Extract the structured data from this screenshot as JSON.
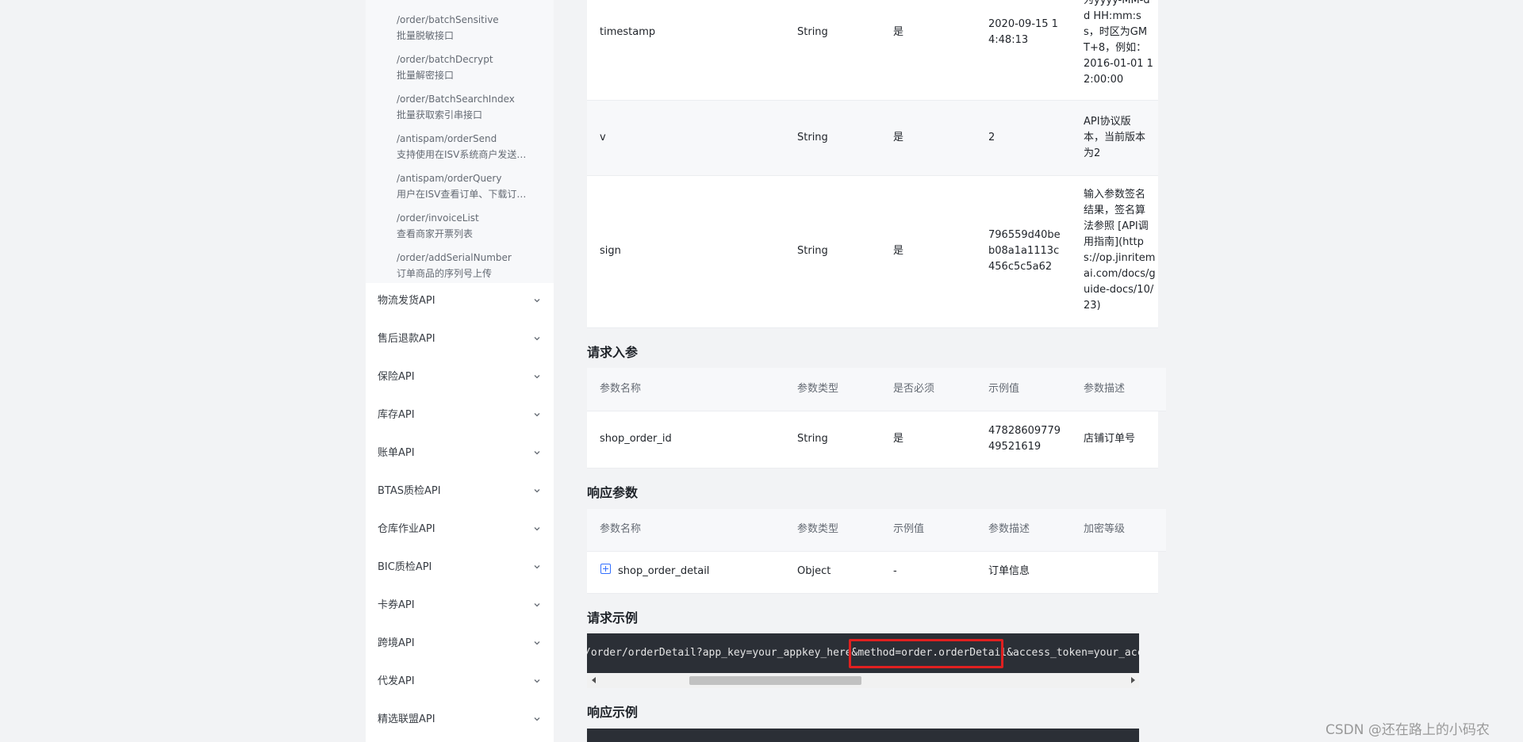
{
  "sidebar": {
    "sub_items": [
      {
        "path": "/order/batchSensitive",
        "desc": "批量脱敏接口"
      },
      {
        "path": "/order/batchDecrypt",
        "desc": "批量解密接口"
      },
      {
        "path": "/order/BatchSearchIndex",
        "desc": "批量获取索引串接口"
      },
      {
        "path": "/antispam/orderSend",
        "desc": "支持使用在ISV系统商户发送（..."
      },
      {
        "path": "/antispam/orderQuery",
        "desc": "用户在ISV查看订单、下载订单..."
      },
      {
        "path": "/order/invoiceList",
        "desc": "查看商家开票列表"
      },
      {
        "path": "/order/addSerialNumber",
        "desc": "订单商品的序列号上传"
      }
    ],
    "categories": [
      {
        "label": "物流发货API"
      },
      {
        "label": "售后退款API"
      },
      {
        "label": "保险API"
      },
      {
        "label": "库存API"
      },
      {
        "label": "账单API"
      },
      {
        "label": "BTAS质检API"
      },
      {
        "label": "仓库作业API"
      },
      {
        "label": "BIC质检API"
      },
      {
        "label": "卡券API"
      },
      {
        "label": "跨境API"
      },
      {
        "label": "代发API"
      },
      {
        "label": "精选联盟API"
      }
    ]
  },
  "common_params": {
    "rows": [
      {
        "name": "timestamp",
        "type": "String",
        "required": "是",
        "example_lines": [
          "2020-09-15 1",
          "4:48:13"
        ],
        "desc_lines": [
          "为yyyy-MM-d",
          "d HH:mm:s",
          "s，时区为GM",
          "T+8，例如：",
          "2016-01-01 1",
          "2:00:00"
        ]
      },
      {
        "name": "v",
        "type": "String",
        "required": "是",
        "example_lines": [
          "2"
        ],
        "desc_lines": [
          "API协议版",
          "本，当前版本",
          "为2"
        ]
      },
      {
        "name": "sign",
        "type": "String",
        "required": "是",
        "example_lines": [
          "796559d40be",
          "b08a1a1113c",
          "456c5c5a62"
        ],
        "desc_lines": [
          "输入参数签名",
          "结果，签名算",
          "法参照 [API调",
          "用指南](http",
          "s://op.jinritem",
          "ai.com/docs/g",
          "uide-docs/10/",
          "23)"
        ]
      }
    ]
  },
  "request_params": {
    "title": "请求入参",
    "headers": [
      "参数名称",
      "参数类型",
      "是否必须",
      "示例值",
      "参数描述"
    ],
    "rows": [
      {
        "name": "shop_order_id",
        "type": "String",
        "required": "是",
        "example_lines": [
          "47828609779",
          "49521619"
        ],
        "desc": "店铺订单号"
      }
    ]
  },
  "response_params": {
    "title": "响应参数",
    "headers": [
      "参数名称",
      "参数类型",
      "示例值",
      "参数描述",
      "加密等级"
    ],
    "rows": [
      {
        "name": "shop_order_detail",
        "type": "Object",
        "example": "-",
        "desc": "订单信息",
        "level": ""
      }
    ]
  },
  "request_example": {
    "title": "请求示例",
    "code": "/order/orderDetail?app_key=your_appkey_here&method=order.orderDetail&access_token=your_acce"
  },
  "response_example": {
    "title": "响应示例"
  },
  "watermark": "CSDN @还在路上的小码农",
  "colors": {
    "highlight": "#e02020",
    "code_bg": "#2b2f36",
    "link": "#3370ff"
  }
}
